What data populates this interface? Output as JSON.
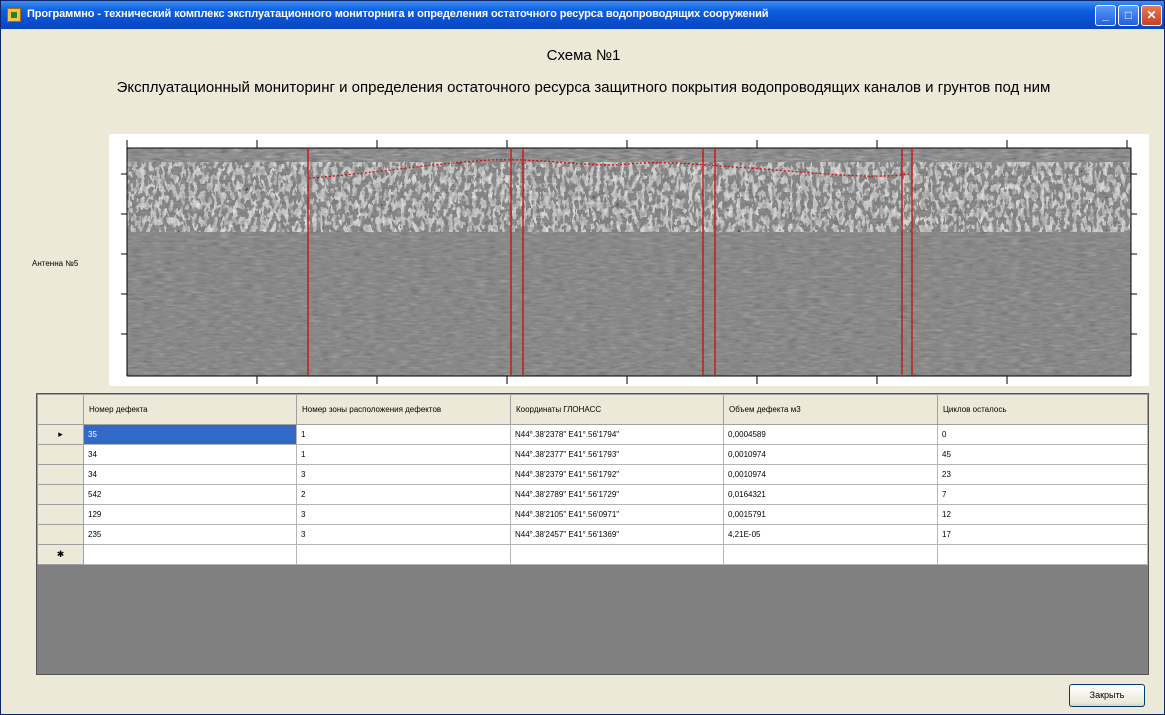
{
  "window": {
    "title": "Программно - технический комплекс эксплуатационного мониторнига и определения остаточного ресурса водопроводящих сооружений",
    "minimize_glyph": "_",
    "maximize_glyph": "□",
    "close_glyph": "✕"
  },
  "header": {
    "title": "Схема №1",
    "subtitle": "Эксплуатационный мониторинг и определения остаточного ресурса защитного покрытия водопроводящих каналов и грунтов под ним"
  },
  "radargram": {
    "label": "Антенна №5"
  },
  "grid": {
    "columns": [
      "Номер дефекта",
      "Номер зоны расположения дефектов",
      "Координаты ГЛОНАСС",
      "Объем дефекта м3",
      "Циклов осталось"
    ],
    "rows": [
      {
        "marker": "▸",
        "cells": [
          "35",
          "1",
          "N44°.38'2378\" E41°.56'1794\"",
          "0,0004589",
          "0"
        ]
      },
      {
        "marker": "",
        "cells": [
          "34",
          "1",
          "N44°.38'2377\" E41°.56'1793\"",
          "0,0010974",
          "45"
        ]
      },
      {
        "marker": "",
        "cells": [
          "34",
          "3",
          "N44°.38'2379\" E41°.56'1792\"",
          "0,0010974",
          "23"
        ]
      },
      {
        "marker": "",
        "cells": [
          "542",
          "2",
          "N44°.38'2789\" E41°.56'1729\"",
          "0,0164321",
          "7"
        ]
      },
      {
        "marker": "",
        "cells": [
          "129",
          "3",
          "N44°.38'2105\" E41°.56'0971\"",
          "0,0015791",
          "12"
        ]
      },
      {
        "marker": "",
        "cells": [
          "235",
          "3",
          "N44°.38'2457\" E41°.56'1369\"",
          "4,21E-05",
          "17"
        ]
      }
    ],
    "new_row_marker": "✱"
  },
  "buttons": {
    "close_label": "Закрыть"
  }
}
